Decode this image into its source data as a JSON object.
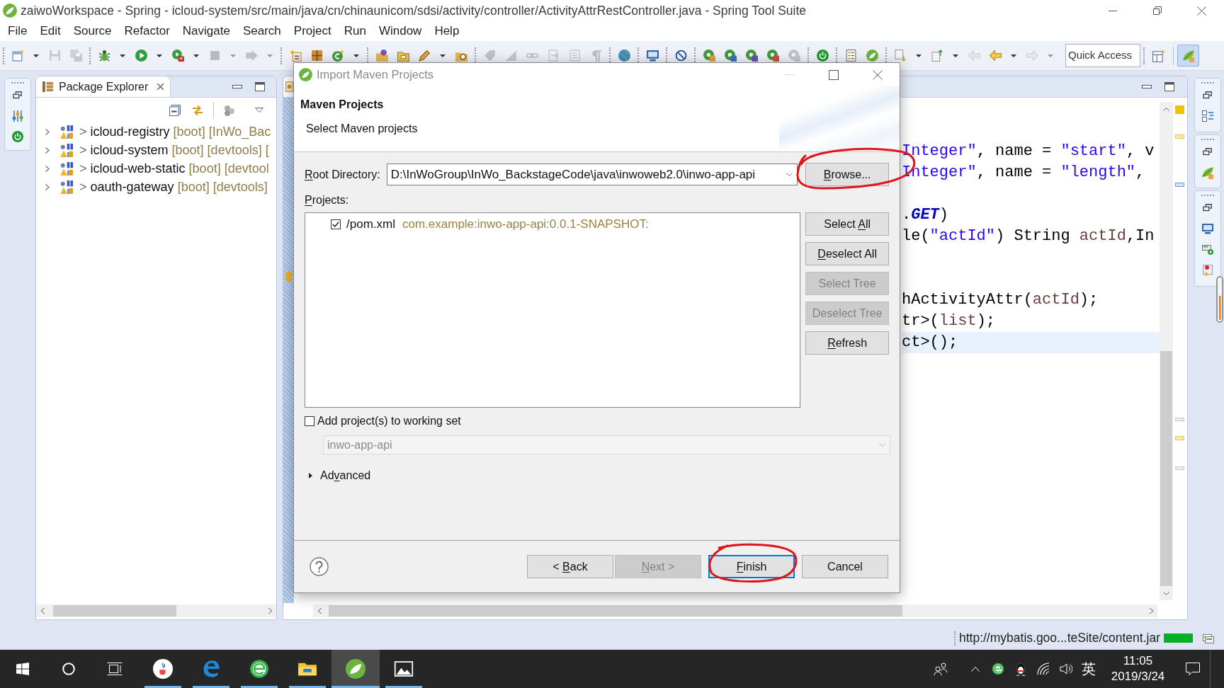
{
  "window": {
    "title": "zaiwoWorkspace - Spring - icloud-system/src/main/java/cn/chinaunicom/sdsi/activity/controller/ActivityAttrRestController.java - Spring Tool Suite"
  },
  "menu": [
    "File",
    "Edit",
    "Source",
    "Refactor",
    "Navigate",
    "Search",
    "Project",
    "Run",
    "Window",
    "Help"
  ],
  "toolbar": {
    "groups": [
      [
        {
          "disabled": false,
          "dropdown": true
        },
        {
          "disabled": true,
          "dropdown": false
        },
        {
          "disabled": true,
          "dropdown": false
        }
      ],
      [
        {
          "disabled": false,
          "dropdown": true
        },
        {
          "disabled": false,
          "dropdown": true
        },
        {
          "disabled": false,
          "dropdown": true
        },
        {
          "disabled": true,
          "dropdown": true
        },
        {
          "disabled": true,
          "dropdown": true
        }
      ],
      [
        {
          "disabled": false,
          "dropdown": false
        },
        {
          "disabled": false,
          "dropdown": false
        },
        {
          "disabled": false,
          "dropdown": true
        }
      ],
      [
        {
          "disabled": false,
          "dropdown": false
        },
        {
          "disabled": false,
          "dropdown": false
        },
        {
          "disabled": false,
          "dropdown": true
        },
        {
          "disabled": false,
          "dropdown": false
        }
      ],
      [
        {
          "disabled": true,
          "dropdown": false
        },
        {
          "disabled": true,
          "dropdown": false
        },
        {
          "disabled": true,
          "dropdown": false
        },
        {
          "disabled": true,
          "dropdown": false
        },
        {
          "disabled": true,
          "dropdown": false
        },
        {
          "disabled": true,
          "dropdown": false
        }
      ],
      [
        {
          "disabled": false,
          "dropdown": false
        }
      ],
      [
        {
          "disabled": false,
          "dropdown": false
        }
      ],
      [
        {
          "disabled": false,
          "dropdown": false
        }
      ],
      [
        {
          "disabled": false,
          "dropdown": false
        },
        {
          "disabled": false,
          "dropdown": false
        },
        {
          "disabled": false,
          "dropdown": false
        },
        {
          "disabled": false,
          "dropdown": false
        },
        {
          "disabled": true,
          "dropdown": false
        }
      ],
      [
        {
          "disabled": false,
          "dropdown": false
        }
      ],
      [
        {
          "disabled": false,
          "dropdown": false
        },
        {
          "disabled": false,
          "dropdown": false
        }
      ],
      [
        {
          "disabled": false,
          "dropdown": true
        },
        {
          "disabled": false,
          "dropdown": true
        },
        {
          "disabled": true,
          "dropdown": false
        },
        {
          "disabled": false,
          "dropdown": true
        },
        {
          "disabled": true,
          "dropdown": true
        }
      ]
    ],
    "quick_access": {
      "placeholder": "Quick Access"
    },
    "perspectives": [
      {
        "selected": false
      },
      {
        "selected": true
      }
    ]
  },
  "package_explorer": {
    "title": "Package Explorer",
    "items": [
      {
        "marker": ">",
        "name": "icloud-registry",
        "decorations": "[boot] [InWo_Bac",
        "expanded": false
      },
      {
        "marker": ">",
        "name": "icloud-system",
        "decorations": "[boot] [devtools] [",
        "expanded": false
      },
      {
        "marker": ">",
        "name": "icloud-web-static",
        "decorations": "[boot] [devtool",
        "expanded": false
      },
      {
        "marker": ">",
        "name": "oauth-gateway",
        "decorations": "[boot] [devtools]",
        "expanded": false
      }
    ]
  },
  "editor": {
    "lines": [
      {
        "kind": "code",
        "current": false,
        "tokens": [
          {
            "kind": "string",
            "text": "Integer\""
          },
          {
            "kind": "plain",
            "text": ", name = "
          },
          {
            "kind": "string",
            "text": "\"start\""
          },
          {
            "kind": "plain",
            "text": ", v"
          }
        ]
      },
      {
        "kind": "code",
        "current": false,
        "tokens": [
          {
            "kind": "string",
            "text": "Integer\""
          },
          {
            "kind": "plain",
            "text": ", name = "
          },
          {
            "kind": "string",
            "text": "\"length\""
          },
          {
            "kind": "plain",
            "text": ","
          }
        ]
      },
      {
        "kind": "blank",
        "current": false
      },
      {
        "kind": "code",
        "current": false,
        "tokens": [
          {
            "kind": "plain",
            "text": "."
          },
          {
            "kind": "static",
            "text": "GET"
          },
          {
            "kind": "plain",
            "text": ")"
          }
        ]
      },
      {
        "kind": "code",
        "current": false,
        "tokens": [
          {
            "kind": "plain",
            "text": "le("
          },
          {
            "kind": "string",
            "text": "\"actId\""
          },
          {
            "kind": "plain",
            "text": ") String "
          },
          {
            "kind": "variable",
            "text": "actId"
          },
          {
            "kind": "plain",
            "text": ",In"
          }
        ]
      },
      {
        "kind": "blank",
        "current": false
      },
      {
        "kind": "blank",
        "current": false
      },
      {
        "kind": "code",
        "current": false,
        "tokens": [
          {
            "kind": "plain",
            "text": "hActivityAttr("
          },
          {
            "kind": "variable",
            "text": "actId"
          },
          {
            "kind": "plain",
            "text": ");"
          }
        ]
      },
      {
        "kind": "code",
        "current": false,
        "tokens": [
          {
            "kind": "plain",
            "text": "tr>("
          },
          {
            "kind": "variable",
            "text": "list"
          },
          {
            "kind": "plain",
            "text": ");"
          }
        ]
      },
      {
        "kind": "code",
        "current": true,
        "tokens": [
          {
            "kind": "plain",
            "text": "ct>();"
          }
        ]
      }
    ]
  },
  "dialog": {
    "title": "Import Maven Projects",
    "heading": "Maven Projects",
    "description": "Select Maven projects",
    "root_directory": {
      "label": {
        "key": "R",
        "after": "oot Directory:"
      },
      "value": "D:\\InWoGroup\\InWo_BackstageCode\\java\\inwoweb2.0\\inwo-app-api"
    },
    "browse_button": {
      "key": "B",
      "after": "rowse..."
    },
    "projects_label": {
      "key": "P",
      "after": "rojects:"
    },
    "projects": [
      {
        "checked": true,
        "path": "/pom.xml",
        "artifact": "com.example:inwo-app-api:0.0.1-SNAPSHOT:"
      }
    ],
    "side_buttons": [
      {
        "label": {
          "before": "Select ",
          "key": "A",
          "after": "ll"
        },
        "disabled": false
      },
      {
        "label": {
          "key": "D",
          "after": "eselect All"
        },
        "disabled": false
      },
      {
        "label": "Select Tree",
        "disabled": true
      },
      {
        "label": "Deselect Tree",
        "disabled": true
      },
      {
        "label": {
          "key": "R",
          "after": "efresh"
        },
        "disabled": false
      }
    ],
    "working_set": {
      "label": "Add project(s) to working set",
      "checked": false,
      "value": "inwo-app-api",
      "disabled": true
    },
    "advanced": {
      "label": {
        "before": "Ad",
        "key": "v",
        "after": "anced"
      },
      "expanded": false
    },
    "footer_buttons": [
      {
        "label": {
          "before": "< ",
          "key": "B",
          "after": "ack"
        },
        "disabled": false,
        "default": false
      },
      {
        "label": {
          "key": "N",
          "after": "ext >"
        },
        "disabled": true,
        "default": false
      },
      {
        "label": {
          "key": "F",
          "after": "inish"
        },
        "disabled": false,
        "default": true
      },
      {
        "label": "Cancel",
        "disabled": false,
        "default": false
      }
    ]
  },
  "status_bar": {
    "message": "http://mybatis.goo...teSite/content.jar",
    "progress": {
      "level": 1
    }
  },
  "taskbar": {
    "apps": [
      {
        "running": true,
        "selected": false
      },
      {
        "running": true,
        "selected": false
      },
      {
        "running": true,
        "selected": false
      },
      {
        "running": true,
        "selected": false
      },
      {
        "running": true,
        "selected": true
      },
      {
        "running": true,
        "selected": false
      }
    ],
    "ime": "英",
    "time": "11:05",
    "date": "2019/3/24"
  }
}
